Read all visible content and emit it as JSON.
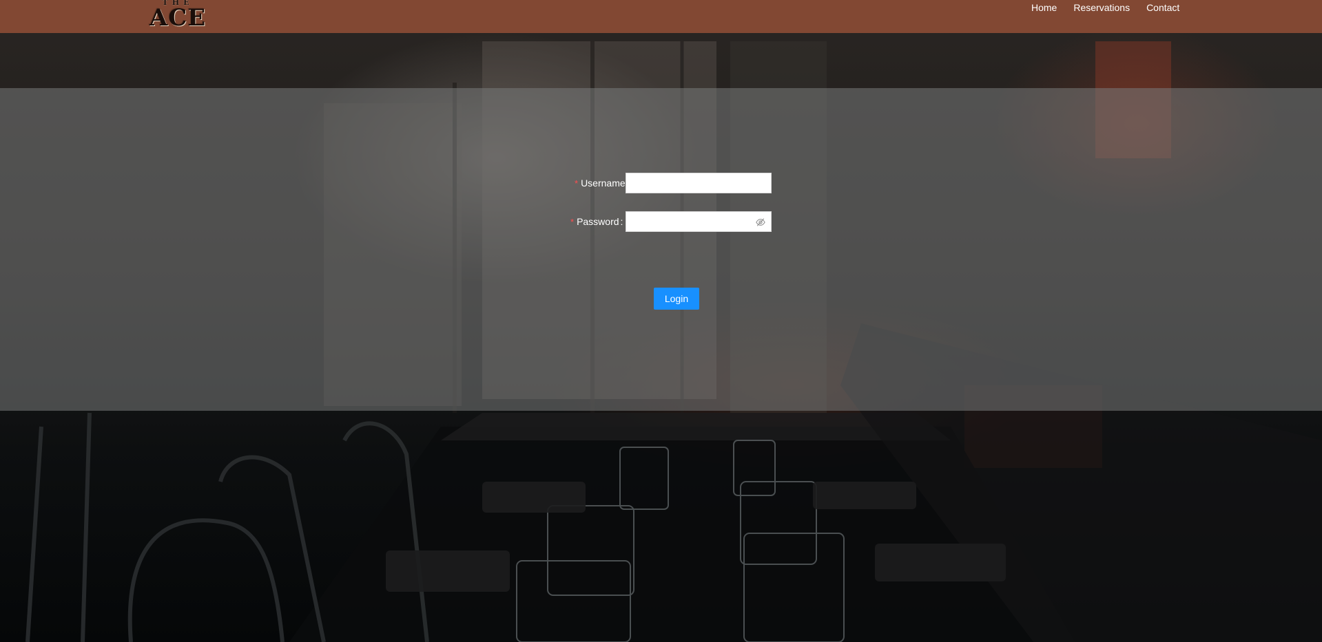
{
  "header": {
    "logo_text_small": "THE",
    "logo_text_big": "ACE",
    "nav": [
      "Home",
      "Reservations",
      "Contact"
    ]
  },
  "login_form": {
    "username_label": "Username",
    "password_label": "Password",
    "password_colon": ":",
    "required_mark": "*",
    "username_value": "",
    "password_value": "",
    "submit_label": "Login"
  },
  "icons": {
    "password_toggle": "eye-invisible-icon"
  },
  "colors": {
    "header_bg": "#965037",
    "primary_button": "#1890ff",
    "required_mark": "#ff4d4f"
  }
}
